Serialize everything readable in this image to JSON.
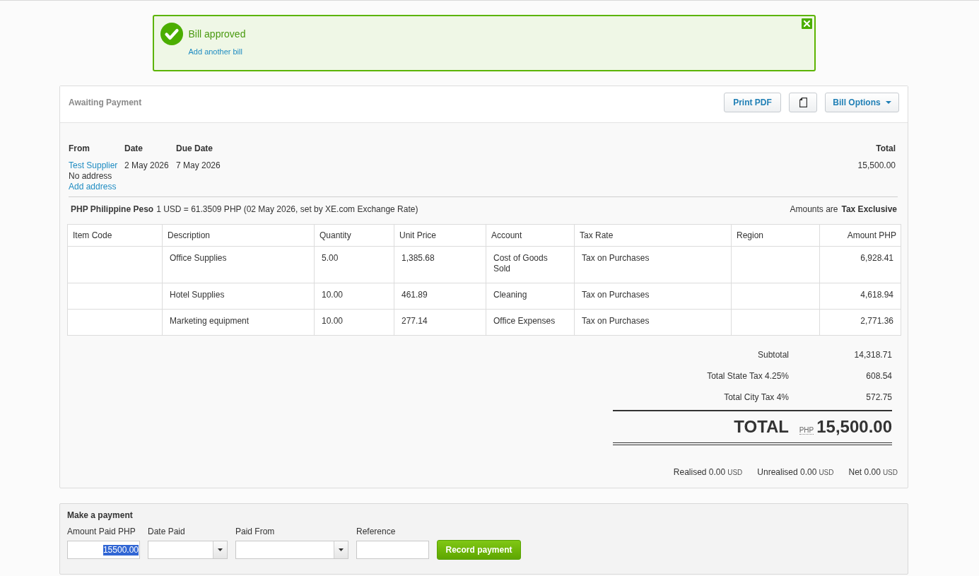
{
  "notification": {
    "title": "Bill approved",
    "link": "Add another bill"
  },
  "bill": {
    "status": "Awaiting Payment",
    "actions": [
      {
        "kind": "text",
        "label": "Print PDF"
      },
      {
        "kind": "icon"
      },
      {
        "kind": "menu",
        "label": "Bill Options"
      }
    ]
  },
  "details": {
    "columns": [
      {
        "heading": "From",
        "lines": [
          {
            "text": "Test Supplier",
            "link": true
          },
          {
            "text": "No address",
            "link": false
          },
          {
            "text": "Add address",
            "link": true
          }
        ]
      },
      {
        "heading": "Date",
        "lines": [
          {
            "text": "2 May 2026",
            "link": false
          }
        ]
      },
      {
        "heading": "Due Date",
        "lines": [
          {
            "text": "7 May 2026",
            "link": false
          }
        ]
      }
    ],
    "total": {
      "heading": "Total",
      "value": "15,500.00"
    }
  },
  "currency": {
    "name": "PHP Philippine Peso",
    "rate_text": "1 USD = 61.3509 PHP (02 May 2026, set by XE.com Exchange Rate)"
  },
  "tax_mode": {
    "label": "Amounts are",
    "value": "Tax Exclusive"
  },
  "table": {
    "columns": [
      {
        "label": "Item Code"
      },
      {
        "label": "Description"
      },
      {
        "label": "Quantity"
      },
      {
        "label": "Unit Price"
      },
      {
        "label": "Account"
      },
      {
        "label": "Tax Rate"
      },
      {
        "label": "Region"
      },
      {
        "label": "Amount PHP"
      }
    ],
    "rows": [
      {
        "description": "Office Supplies",
        "quantity": "5.00",
        "unit_price": "1,385.68",
        "account": "Cost of Goods Sold",
        "tax_rate": "Tax on Purchases",
        "amount": "6,928.41"
      },
      {
        "description": "Hotel Supplies",
        "quantity": "10.00",
        "unit_price": "461.89",
        "account": "Cleaning",
        "tax_rate": "Tax on Purchases",
        "amount": "4,618.94"
      },
      {
        "description": "Marketing equipment",
        "quantity": "10.00",
        "unit_price": "277.14",
        "account": "Office Expenses",
        "tax_rate": "Tax on Purchases",
        "amount": "2,771.36"
      }
    ]
  },
  "totals": {
    "lines": [
      {
        "label": "Subtotal",
        "value": "14,318.71"
      },
      {
        "label": "Total State Tax 4.25%",
        "value": "608.54"
      },
      {
        "label": "Total City Tax 4%",
        "value": "572.75"
      }
    ],
    "grand_total": {
      "label": "TOTAL",
      "currency": "PHP",
      "value": "15,500.00"
    }
  },
  "gains": [
    {
      "text": "Realised 0.00",
      "currency": "USD"
    },
    {
      "text": "Unrealised 0.00",
      "currency": "USD"
    },
    {
      "text": "Net 0.00",
      "currency": "USD"
    }
  ],
  "payment": {
    "title": "Make a payment",
    "fields": [
      {
        "kind": "text",
        "label": "Amount Paid PHP",
        "value": "15500.00",
        "highlighted": true
      },
      {
        "kind": "dropdown",
        "label": "Date Paid"
      },
      {
        "kind": "dropdown",
        "label": "Paid From"
      },
      {
        "kind": "text",
        "label": "Reference"
      }
    ],
    "button": "Record payment"
  }
}
